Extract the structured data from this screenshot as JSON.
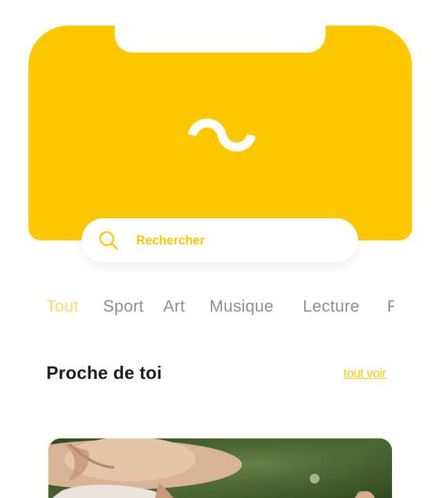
{
  "colors": {
    "brand_yellow": "#FFC700",
    "active_tab": "#FFD766",
    "inactive_tab": "#8f8f8f",
    "title_text": "#1d1d1d"
  },
  "header": {
    "logo_icon": "wave-logo-icon"
  },
  "search": {
    "icon": "search-icon",
    "placeholder": "Rechercher"
  },
  "categories": {
    "items": [
      {
        "label": "Tout",
        "active": true
      },
      {
        "label": "Sport",
        "active": false
      },
      {
        "label": "Art",
        "active": false
      },
      {
        "label": "Musique",
        "active": false
      },
      {
        "label": "Lecture",
        "active": false
      },
      {
        "label": "F",
        "active": false
      }
    ]
  },
  "section": {
    "title": "Proche de toi",
    "see_all": "tout voir"
  },
  "card": {
    "image": "photo-woman-sun-hat"
  }
}
